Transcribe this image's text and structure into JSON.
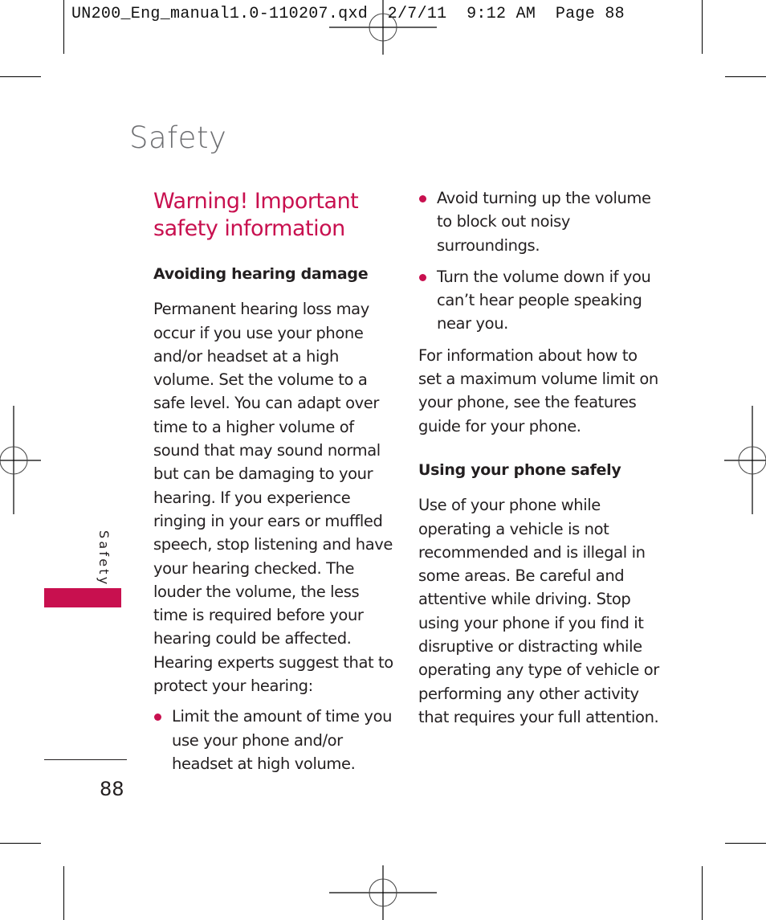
{
  "slug": {
    "filename": "UN200_Eng_manual1.0-110207.qxd",
    "date": "2/7/11",
    "time": "9:12 AM",
    "page_label": "Page 88"
  },
  "colors": {
    "accent": "#C8104F",
    "title_gray": "#6D6E71",
    "text": "#231F20"
  },
  "page": {
    "title": "Safety",
    "side_tab_label": "Safety",
    "page_number": "88"
  },
  "section": {
    "heading_line1": "Warning! Important",
    "heading_line2": "safety information"
  },
  "hearing": {
    "subheading": "Avoiding hearing damage",
    "paragraph": "Permanent hearing loss may occur if you use your phone and/or headset at a high volume. Set the volume to a safe level. You can adapt over time to a higher volume of sound that may sound normal but can be damaging to your hearing. If you experience ringing in your ears or muffled speech, stop listening and have your hearing checked. The louder the volume, the less time is required before your hearing could be affected. Hearing experts suggest that to protect your hearing:",
    "bullets": [
      "Limit the amount of time you use your phone and/or headset at high volume.",
      "Avoid turning up the volume to block out noisy surroundings.",
      "Turn the volume down if you can’t hear people speaking near you."
    ],
    "followup": "For information about how to set a maximum volume limit on your phone, see the features guide for your phone."
  },
  "driving": {
    "subheading": "Using your phone safely",
    "paragraph": "Use of your phone while operating a vehicle is not recommended and is illegal in some areas. Be careful and attentive while driving. Stop using your phone if you find it disruptive or distracting while operating any type of vehicle or performing any other activity that requires your full attention."
  }
}
